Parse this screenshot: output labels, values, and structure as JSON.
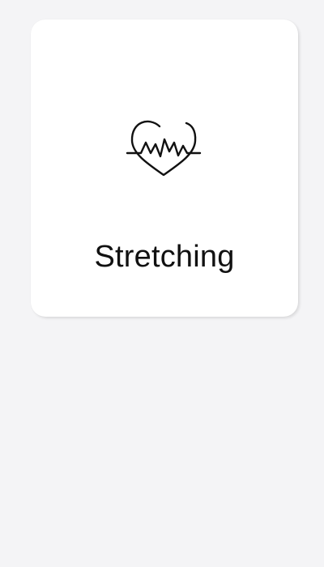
{
  "activity_card": {
    "label": "Stretching",
    "icon": "heart-pulse-icon"
  }
}
